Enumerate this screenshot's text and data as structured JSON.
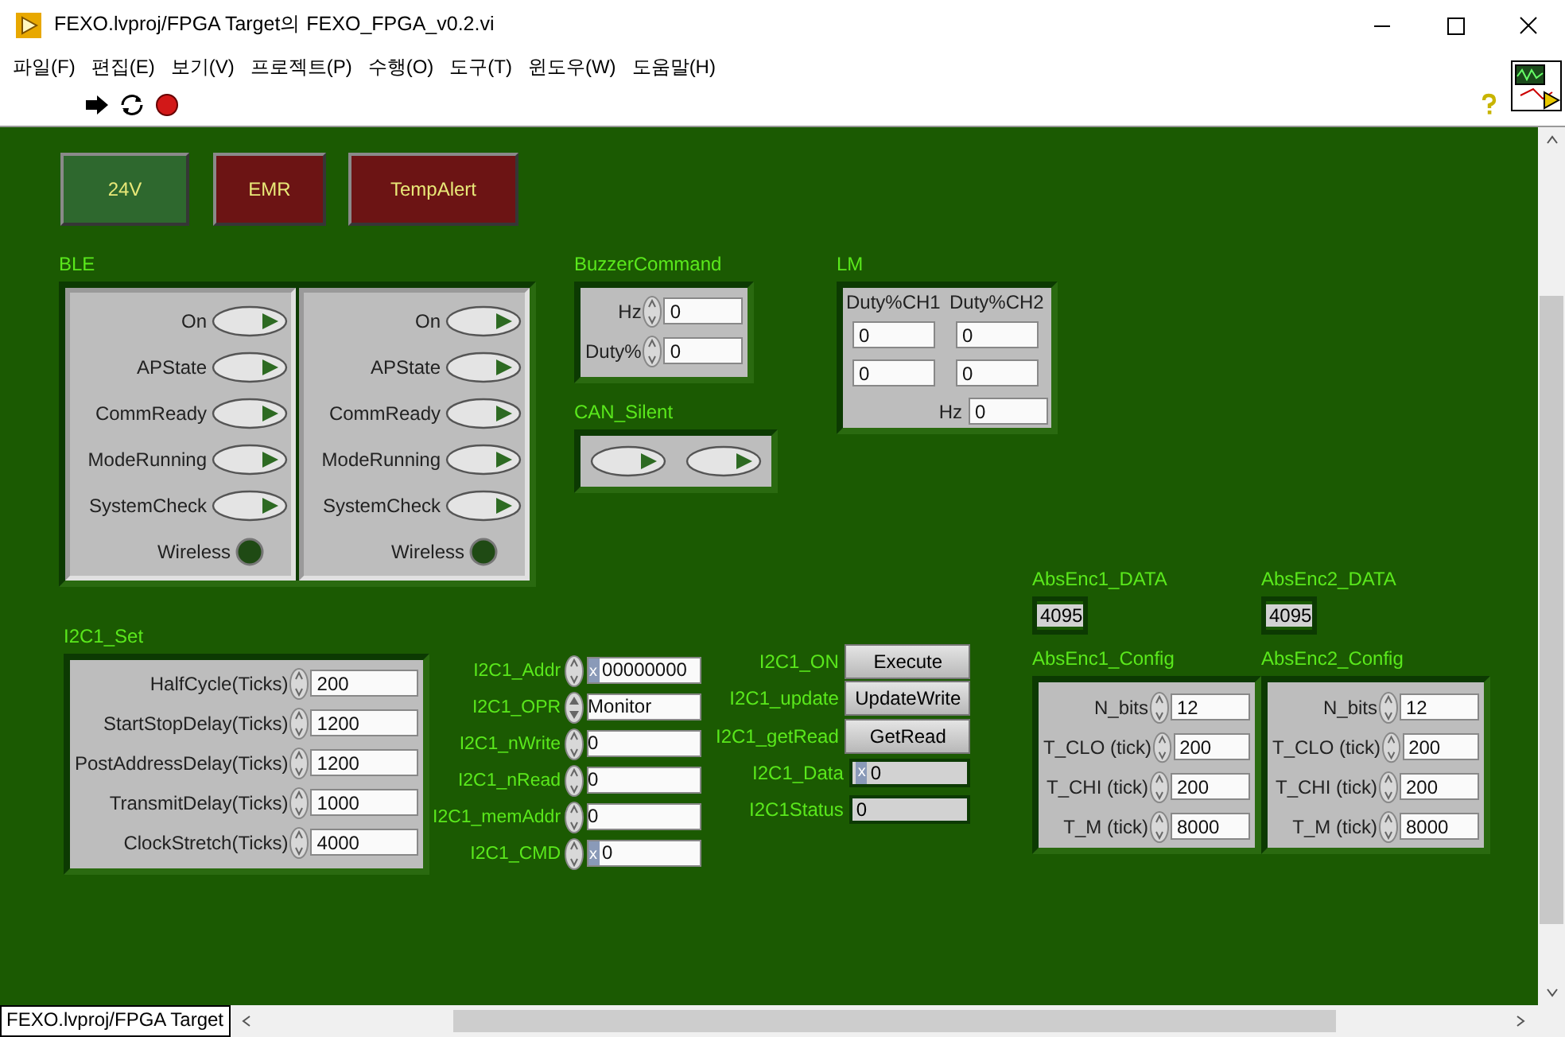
{
  "window": {
    "title": "FEXO.lvproj/FPGA Target의 FEXO_FPGA_v0.2.vi"
  },
  "menu": [
    "파일(F)",
    "편집(E)",
    "보기(V)",
    "프로젝트(P)",
    "수행(O)",
    "도구(T)",
    "윈도우(W)",
    "도움말(H)"
  ],
  "buttons": [
    {
      "label": "24V",
      "color": "#2e682e"
    },
    {
      "label": "EMR",
      "color": "#6c1414"
    },
    {
      "label": "TempAlert",
      "color": "#6c1414"
    }
  ],
  "ble": {
    "label": "BLE",
    "clusters": [
      {
        "items": [
          {
            "label": "On",
            "kind": "switch",
            "on": false
          },
          {
            "label": "APState",
            "kind": "switch",
            "on": false
          },
          {
            "label": "CommReady",
            "kind": "switch",
            "on": false
          },
          {
            "label": "ModeRunning",
            "kind": "switch",
            "on": false
          },
          {
            "label": "SystemCheck",
            "kind": "switch",
            "on": false
          },
          {
            "label": "Wireless",
            "kind": "led",
            "on": false
          }
        ]
      },
      {
        "items": [
          {
            "label": "On",
            "kind": "switch",
            "on": false
          },
          {
            "label": "APState",
            "kind": "switch",
            "on": false
          },
          {
            "label": "CommReady",
            "kind": "switch",
            "on": false
          },
          {
            "label": "ModeRunning",
            "kind": "switch",
            "on": false
          },
          {
            "label": "SystemCheck",
            "kind": "switch",
            "on": false
          },
          {
            "label": "Wireless",
            "kind": "led",
            "on": false
          }
        ]
      }
    ]
  },
  "buzzer": {
    "label": "BuzzerCommand",
    "fields": [
      {
        "label": "Hz",
        "value": "0"
      },
      {
        "label": "Duty%",
        "value": "0"
      }
    ]
  },
  "can_silent": {
    "label": "CAN_Silent",
    "switches": [
      {
        "on": false
      },
      {
        "on": false
      }
    ]
  },
  "lm": {
    "label": "LM",
    "columns": [
      "Duty%CH1",
      "Duty%CH2"
    ],
    "rows": [
      [
        "0",
        "0"
      ],
      [
        "0",
        "0"
      ]
    ],
    "hz": {
      "label": "Hz",
      "value": "0"
    }
  },
  "i2c_set": {
    "label": "I2C1_Set",
    "fields": [
      {
        "label": "HalfCycle(Ticks)",
        "value": "200"
      },
      {
        "label": "StartStopDelay(Ticks)",
        "value": "1200"
      },
      {
        "label": "PostAddressDelay(Ticks)",
        "value": "1200"
      },
      {
        "label": "TransmitDelay(Ticks)",
        "value": "1000"
      },
      {
        "label": "ClockStretch(Ticks)",
        "value": "4000"
      }
    ]
  },
  "i2c_controls": [
    {
      "label": "I2C1_Addr",
      "kind": "numeric",
      "radix": "x",
      "value": "00000000"
    },
    {
      "label": "I2C1_OPR",
      "kind": "ring",
      "value": "Monitor"
    },
    {
      "label": "I2C1_nWrite",
      "kind": "numeric",
      "value": "0"
    },
    {
      "label": "I2C1_nRead",
      "kind": "numeric",
      "value": "0"
    },
    {
      "label": "I2C1_memAddr",
      "kind": "numeric",
      "value": "0"
    },
    {
      "label": "I2C1_CMD",
      "kind": "numeric",
      "radix": "x",
      "value": "0"
    }
  ],
  "i2c_buttons": [
    {
      "label": "I2C1_ON",
      "button": "Execute"
    },
    {
      "label": "I2C1_update",
      "button": "UpdateWrite"
    },
    {
      "label": "I2C1_getRead",
      "button": "GetRead"
    }
  ],
  "i2c_indicators": [
    {
      "label": "I2C1_Data",
      "radix": "x",
      "value": "0"
    },
    {
      "label": "I2C1Status",
      "value": "0"
    }
  ],
  "encoders": [
    {
      "data_label": "AbsEnc1_DATA",
      "data": "4095",
      "config_label": "AbsEnc1_Config",
      "fields": [
        {
          "label": "N_bits",
          "value": "12"
        },
        {
          "label": "T_CLO (tick)",
          "value": "200"
        },
        {
          "label": "T_CHI (tick)",
          "value": "200"
        },
        {
          "label": "T_M (tick)",
          "value": "8000"
        }
      ]
    },
    {
      "data_label": "AbsEnc2_DATA",
      "data": "4095",
      "config_label": "AbsEnc2_Config",
      "fields": [
        {
          "label": "N_bits",
          "value": "12"
        },
        {
          "label": "T_CLO (tick)",
          "value": "200"
        },
        {
          "label": "T_CHI (tick)",
          "value": "200"
        },
        {
          "label": "T_M (tick)",
          "value": "8000"
        }
      ]
    }
  ],
  "status_bar": {
    "target": "FEXO.lvproj/FPGA Target"
  }
}
